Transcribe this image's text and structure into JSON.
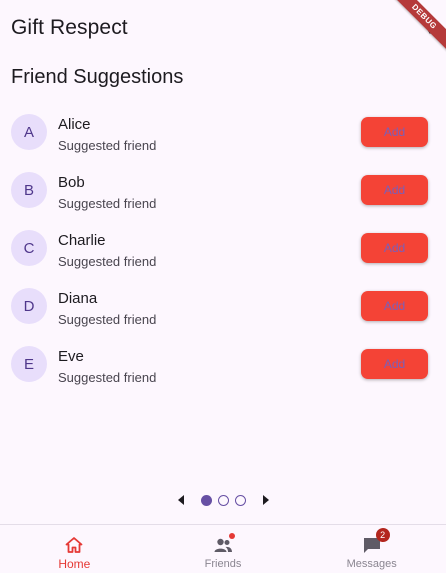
{
  "app_bar": {
    "title": "Gift Respect",
    "debug_banner": "DEBUG"
  },
  "section": {
    "title": "Friend Suggestions"
  },
  "friends": [
    {
      "initial": "A",
      "name": "Alice",
      "subtitle": "Suggested friend",
      "button": "Add"
    },
    {
      "initial": "B",
      "name": "Bob",
      "subtitle": "Suggested friend",
      "button": "Add"
    },
    {
      "initial": "C",
      "name": "Charlie",
      "subtitle": "Suggested friend",
      "button": "Add"
    },
    {
      "initial": "D",
      "name": "Diana",
      "subtitle": "Suggested friend",
      "button": "Add"
    },
    {
      "initial": "E",
      "name": "Eve",
      "subtitle": "Suggested friend",
      "button": "Add"
    }
  ],
  "pager": {
    "pages": 3,
    "current": 1
  },
  "nav": {
    "items": [
      {
        "label": "Home",
        "icon": "home-icon",
        "active": true
      },
      {
        "label": "Friends",
        "icon": "people-icon",
        "active": false
      },
      {
        "label": "Messages",
        "icon": "chat-icon",
        "active": false,
        "badge": "2"
      }
    ]
  },
  "colors": {
    "primary": "#6750a4",
    "accent": "#f44336",
    "background": "#fdf7fe"
  }
}
